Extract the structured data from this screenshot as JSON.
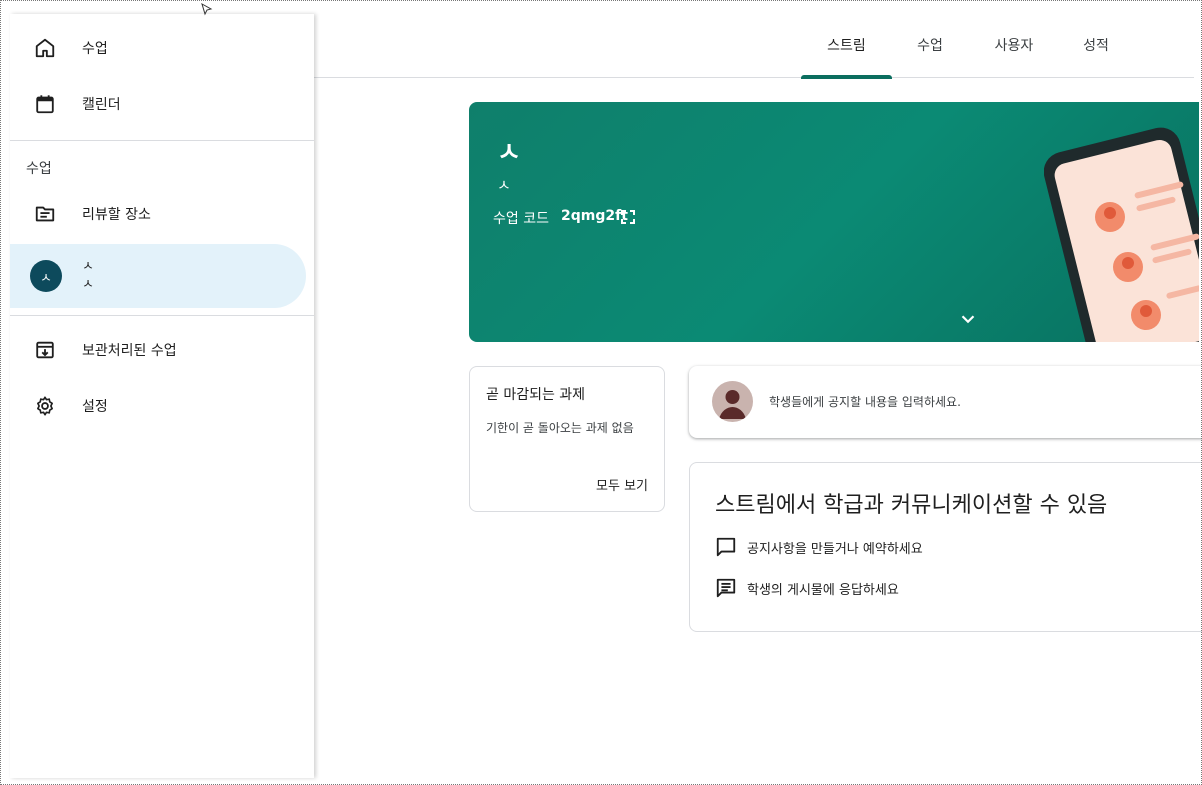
{
  "header": {
    "tabs": [
      {
        "label": "스트림",
        "active": true
      },
      {
        "label": "수업",
        "active": false
      },
      {
        "label": "사용자",
        "active": false
      },
      {
        "label": "성적",
        "active": false
      }
    ]
  },
  "sidebar": {
    "items_top": [
      {
        "label": "수업",
        "icon": "home-icon"
      },
      {
        "label": "캘린더",
        "icon": "calendar-icon"
      }
    ],
    "section_label": "수업",
    "review": {
      "label": "리뷰할 장소",
      "icon": "review-icon"
    },
    "class_item": {
      "avatar": "ㅅ",
      "line1": "ㅅ",
      "line2": "ㅅ"
    },
    "items_bottom": [
      {
        "label": "보관처리된 수업",
        "icon": "archive-icon"
      },
      {
        "label": "설정",
        "icon": "gear-icon"
      }
    ]
  },
  "banner": {
    "title": "ㅅ",
    "subtitle": "ㅅ",
    "code_label": "수업 코드",
    "code": "2qmg2ft",
    "color": "#0b8a73"
  },
  "upcoming": {
    "title": "곧 마감되는 과제",
    "body": "기한이 곧 돌아오는 과제 없음",
    "link": "모두 보기"
  },
  "announce": {
    "placeholder": "학생들에게 공지할 내용을 입력하세요."
  },
  "info": {
    "title": "스트림에서 학급과 커뮤니케이션할 수 있음",
    "rows": [
      {
        "text": "공지사항을 만들거나 예약하세요",
        "icon": "comment-icon"
      },
      {
        "text": "학생의 게시물에 응답하세요",
        "icon": "message-icon"
      }
    ]
  }
}
